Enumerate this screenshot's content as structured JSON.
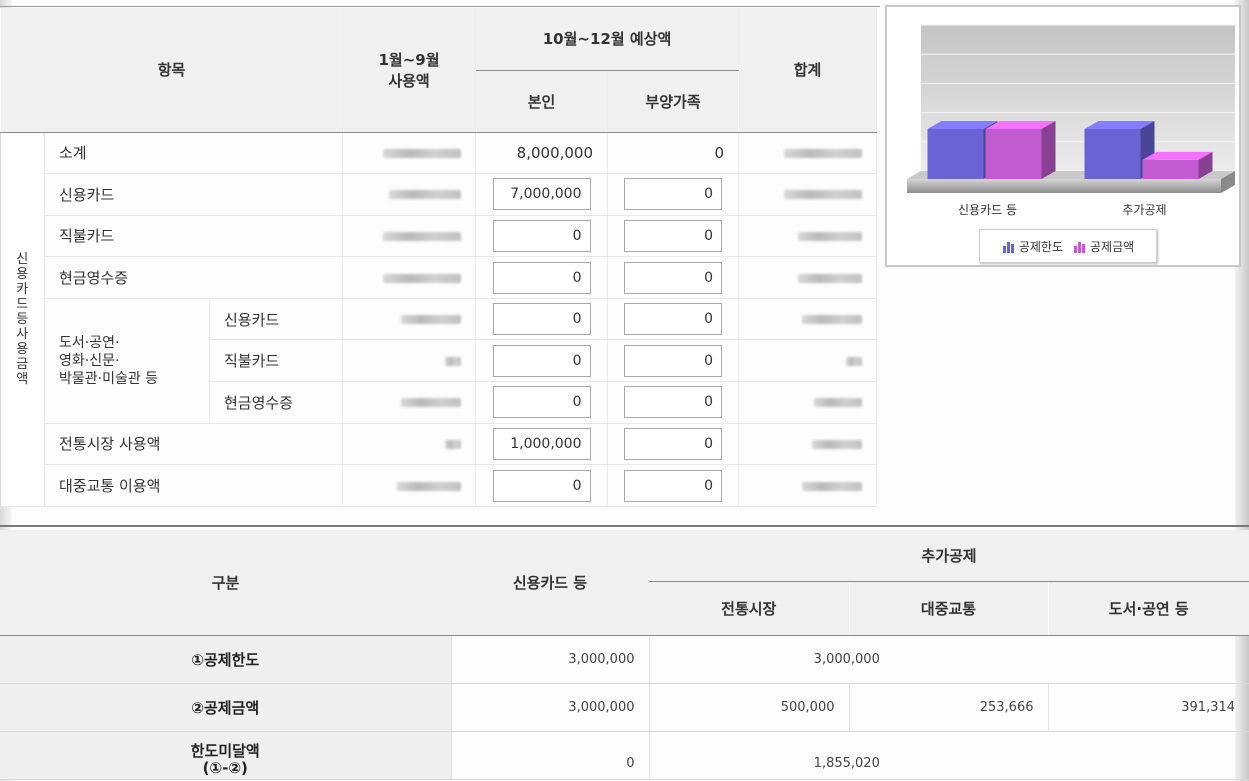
{
  "usage_table": {
    "header": {
      "item": "항목",
      "jan_sep_line1": "1월~9월",
      "jan_sep_line2": "사용액",
      "oct_dec": "10월~12월 예상액",
      "self": "본인",
      "dependents": "부양가족",
      "total": "합계"
    },
    "side_label": "신용카드등 사용금액",
    "rows": [
      {
        "label": "소계",
        "self": "8,000,000",
        "dependents": "0"
      },
      {
        "label": "신용카드",
        "self": "7,000,000",
        "dependents": "0"
      },
      {
        "label": "직불카드",
        "self": "0",
        "dependents": "0"
      },
      {
        "label": "현금영수증",
        "self": "0",
        "dependents": "0"
      },
      {
        "label": "신용카드",
        "self": "0",
        "dependents": "0"
      },
      {
        "label": "직불카드",
        "self": "0",
        "dependents": "0"
      },
      {
        "label": "현금영수증",
        "self": "0",
        "dependents": "0"
      },
      {
        "label": "전통시장 사용액",
        "self": "1,000,000",
        "dependents": "0"
      },
      {
        "label": "대중교통 이용액",
        "self": "0",
        "dependents": "0"
      }
    ],
    "group_label_line1": "도서·공연·",
    "group_label_line2": "영화·신문·",
    "group_label_line3": "박물관·미술관 등"
  },
  "chart": {
    "legend": [
      "공제한도",
      "공제금액"
    ],
    "categories": [
      "신용카드 등",
      "추가공제"
    ],
    "colors": {
      "limit": "#6a63d6",
      "amount": "#c25bd0"
    }
  },
  "chart_data": {
    "type": "bar",
    "categories": [
      "신용카드 등",
      "추가공제"
    ],
    "series": [
      {
        "name": "공제한도",
        "values": [
          3000000,
          3000000
        ]
      },
      {
        "name": "공제금액",
        "values": [
          3000000,
          1144980
        ]
      }
    ],
    "title": "",
    "xlabel": "",
    "ylabel": "",
    "ylim": [
      0,
      3000000
    ],
    "grid": true,
    "legend": "bottom"
  },
  "deduction_table": {
    "header": {
      "category": "구분",
      "credit_card": "신용카드 등",
      "additional": "추가공제",
      "market": "전통시장",
      "transit": "대중교통",
      "books": "도서·공연 등"
    },
    "rows": [
      {
        "label": "①공제한도",
        "credit": "3,000,000",
        "additional": "3,000,000"
      },
      {
        "label": "②공제금액",
        "credit": "3,000,000",
        "market": "500,000",
        "transit": "253,666",
        "books": "391,314"
      },
      {
        "label_line1": "한도미달액",
        "label_line2": "(①-②)",
        "credit": "0",
        "additional": "1,855,020"
      }
    ]
  }
}
